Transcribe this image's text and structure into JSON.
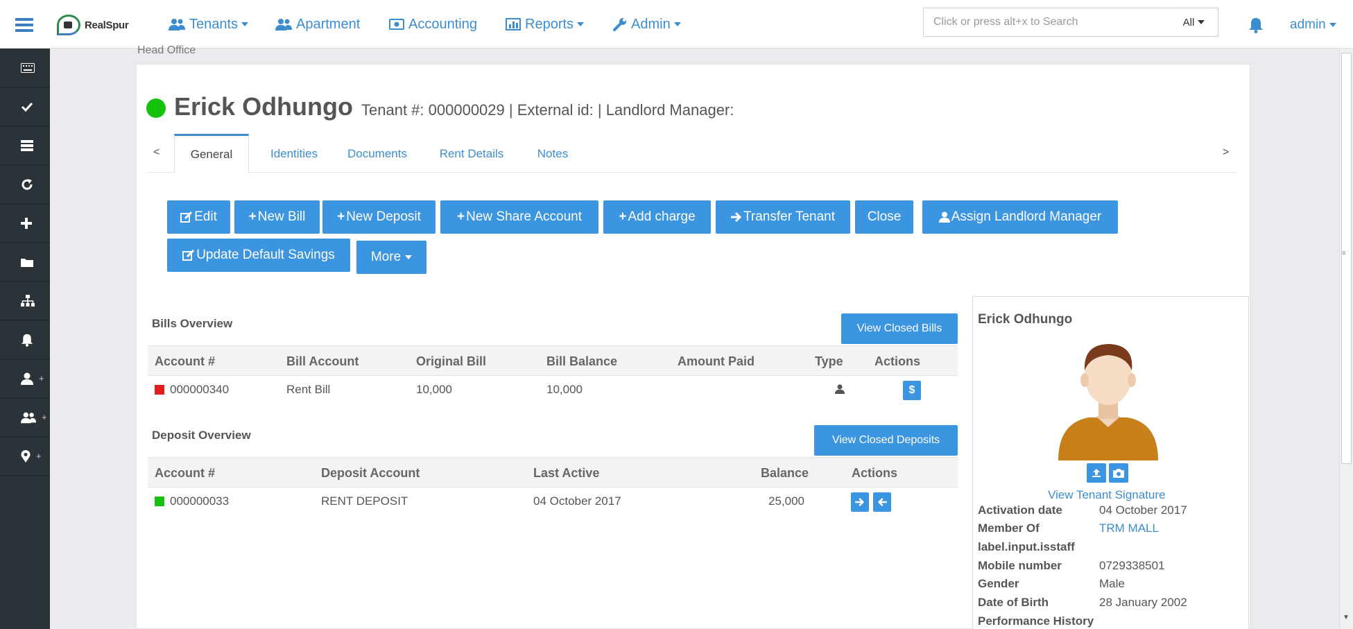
{
  "nav": {
    "logo_text": "RealSpur",
    "tenants": "Tenants",
    "apartment": "Apartment",
    "accounting": "Accounting",
    "reports": "Reports",
    "admin": "Admin",
    "search_placeholder": "Click or press alt+x to Search",
    "search_scope": "All",
    "user": "admin"
  },
  "breadcrumb": "Head Office",
  "tenant": {
    "name": "Erick Odhungo",
    "meta": "Tenant #: 000000029 | External id: | Landlord Manager:",
    "status_color": "#17c20c"
  },
  "tabs": {
    "prev": "<",
    "next": ">",
    "items": [
      "General",
      "Identities",
      "Documents",
      "Rent Details",
      "Notes"
    ]
  },
  "buttons": {
    "edit": "Edit",
    "new_bill": "New Bill",
    "new_deposit": "New Deposit",
    "new_share_account": "New Share Account",
    "add_charge": "Add charge",
    "transfer_tenant": "Transfer Tenant",
    "close": "Close",
    "assign_landlord_manager": "Assign Landlord Manager",
    "update_default_savings": "Update Default Savings",
    "more": "More"
  },
  "bills": {
    "title": "Bills Overview",
    "view_closed": "View Closed Bills",
    "columns": [
      "Account #",
      "Bill Account",
      "Original Bill",
      "Bill Balance",
      "Amount Paid",
      "Type",
      "Actions"
    ],
    "rows": [
      {
        "account": "000000340",
        "bill_account": "Rent Bill",
        "original": "10,000",
        "balance": "10,000",
        "paid": "",
        "status_color": "#e51c1c"
      }
    ]
  },
  "deposits": {
    "title": "Deposit Overview",
    "view_closed": "View Closed Deposits",
    "columns": [
      "Account #",
      "Deposit Account",
      "Last Active",
      "Balance",
      "Actions"
    ],
    "rows": [
      {
        "account": "000000033",
        "deposit_account": "RENT DEPOSIT",
        "last_active": "04 October 2017",
        "balance": "25,000",
        "status_color": "#17c20c"
      }
    ]
  },
  "profile": {
    "name": "Erick Odhungo",
    "signature_link": "View Tenant Signature",
    "fields": [
      {
        "label": "Activation date",
        "value": "04 October 2017",
        "link": false
      },
      {
        "label": "Member Of",
        "value": "TRM MALL",
        "link": true
      },
      {
        "label": "label.input.isstaff",
        "value": "",
        "link": false
      },
      {
        "label": "Mobile number",
        "value": "0729338501",
        "link": false
      },
      {
        "label": "Gender",
        "value": "Male",
        "link": false
      },
      {
        "label": "Date of Birth",
        "value": "28 January 2002",
        "link": false
      },
      {
        "label": "Performance History",
        "value": "",
        "link": false
      }
    ]
  },
  "colors": {
    "primary": "#3c95e0",
    "link": "#3c8dcf",
    "sidebar": "#2c3338"
  },
  "icons": {
    "sidebar": [
      "keyboard-icon",
      "check-icon",
      "server-icon",
      "refresh-icon",
      "plus-icon",
      "folder-icon",
      "sitemap-icon",
      "bell-icon",
      "user-plus-icon",
      "users-plus-icon",
      "map-marker-plus-icon"
    ]
  }
}
